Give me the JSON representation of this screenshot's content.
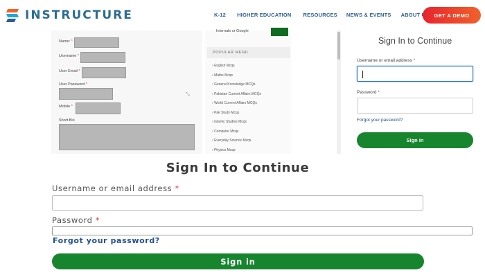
{
  "nav": {
    "logo_text": "INSTRUCTURE",
    "items": [
      "K-12",
      "HIGHER EDUCATION",
      "RESOURCES",
      "NEWS & EVENTS",
      "ABOUT US"
    ],
    "cta": "GET A DEMO"
  },
  "registration": {
    "fields": [
      {
        "label": "Name:",
        "required": "*"
      },
      {
        "label": "Username",
        "required": "*"
      },
      {
        "label": "User Email",
        "required": "*"
      },
      {
        "label": "User Password",
        "required": "*"
      },
      {
        "label": "Mobile",
        "required": "*"
      },
      {
        "label": "Short Bio",
        "required": ""
      }
    ]
  },
  "sidebar": {
    "google_text": "Internals or Google",
    "menu_title": "POPULAR MENU",
    "items": [
      "English Mcqs",
      "Maths Mcqs",
      "General Knowledge MCQs",
      "Pakistan Current Affairs MCQs",
      "World Current Affairs MCQs",
      "Pak Study Mcqs",
      "Islamic Studies Mcqs",
      "Computer Mcqs",
      "Everyday Science Mcqs",
      "Physics Mcqs"
    ]
  },
  "small_signin": {
    "title": "Sign In to Continue",
    "username_label": "Username or email address",
    "password_label": "Password",
    "required": "*",
    "forgot": "Forgot your password?",
    "button": "Sign in"
  },
  "big_signin": {
    "title": "Sign In to Continue",
    "username_label": "Username or email address",
    "password_label": "Password",
    "required": "*",
    "forgot": "Forgot your password?",
    "button": "Sign in"
  },
  "colors": {
    "brand_blue": "#2b6d8f",
    "nav_link": "#2a5d94",
    "cta_start": "#e8232e",
    "cta_end": "#f0622b",
    "signin_green": "#17852e",
    "link_blue": "#1f4e8a"
  }
}
